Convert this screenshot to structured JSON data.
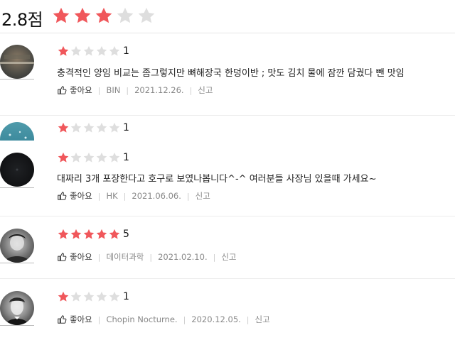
{
  "summary": {
    "score": "2.8점",
    "stars_filled": 3,
    "stars_total": 5
  },
  "colors": {
    "star_on": "#f0575b",
    "star_off": "#dedede"
  },
  "like_label": "좋아요",
  "report_label": "신고",
  "reviews": [
    {
      "rating": 1,
      "rating_text": "1",
      "text": "충격적인 양임 비교는 좀그렇지만 뼈해장국 한덩이반 ; 맛도 김치 물에 잠깐 담궜다 뺀 맛임",
      "author": "BIN",
      "date": "2021.12.26."
    },
    {
      "rating": 1,
      "rating_text": "1",
      "text": "",
      "author": "",
      "date": ""
    },
    {
      "rating": 1,
      "rating_text": "1",
      "text": "대짜리 3개 포장한다고 호구로 보였나봅니다^-^ 여러분들 사장님 있을때 가세요~",
      "author": "HK",
      "date": "2021.06.06."
    },
    {
      "rating": 5,
      "rating_text": "5",
      "text": "",
      "author": "데이터과학",
      "date": "2021.02.10."
    },
    {
      "rating": 1,
      "rating_text": "1",
      "text": "",
      "author": "Chopin Nocturne.",
      "date": "2020.12.05."
    }
  ]
}
